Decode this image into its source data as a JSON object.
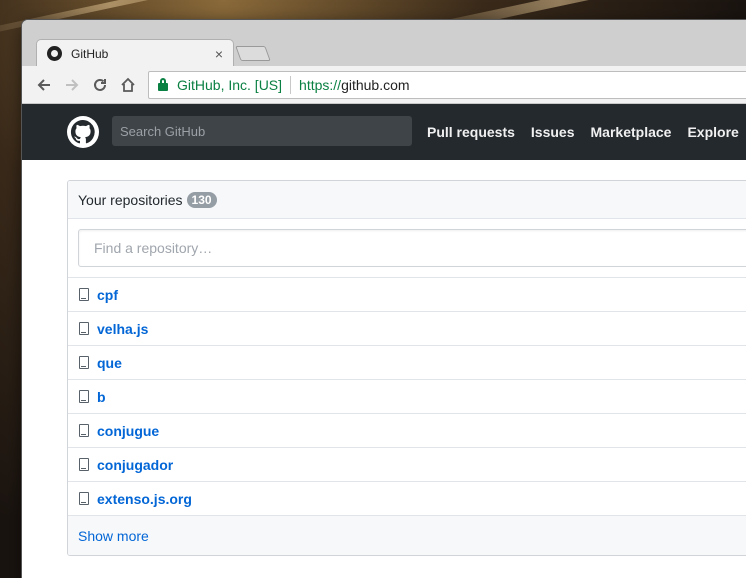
{
  "browser": {
    "tab_title": "GitHub",
    "tab_close": "×",
    "security_label": "GitHub, Inc. [US]",
    "url_scheme": "https://",
    "url_host": "github.com"
  },
  "header": {
    "search_placeholder": "Search GitHub",
    "nav": [
      "Pull requests",
      "Issues",
      "Marketplace",
      "Explore"
    ]
  },
  "repositories": {
    "title": "Your repositories",
    "count": "130",
    "filter_placeholder": "Find a repository…",
    "items": [
      "cpf",
      "velha.js",
      "que",
      "b",
      "conjugue",
      "conjugador",
      "extenso.js.org"
    ],
    "show_more": "Show more"
  },
  "colors": {
    "header_bg": "#24292e",
    "link": "#0366d6",
    "secure_green": "#0b8043"
  }
}
